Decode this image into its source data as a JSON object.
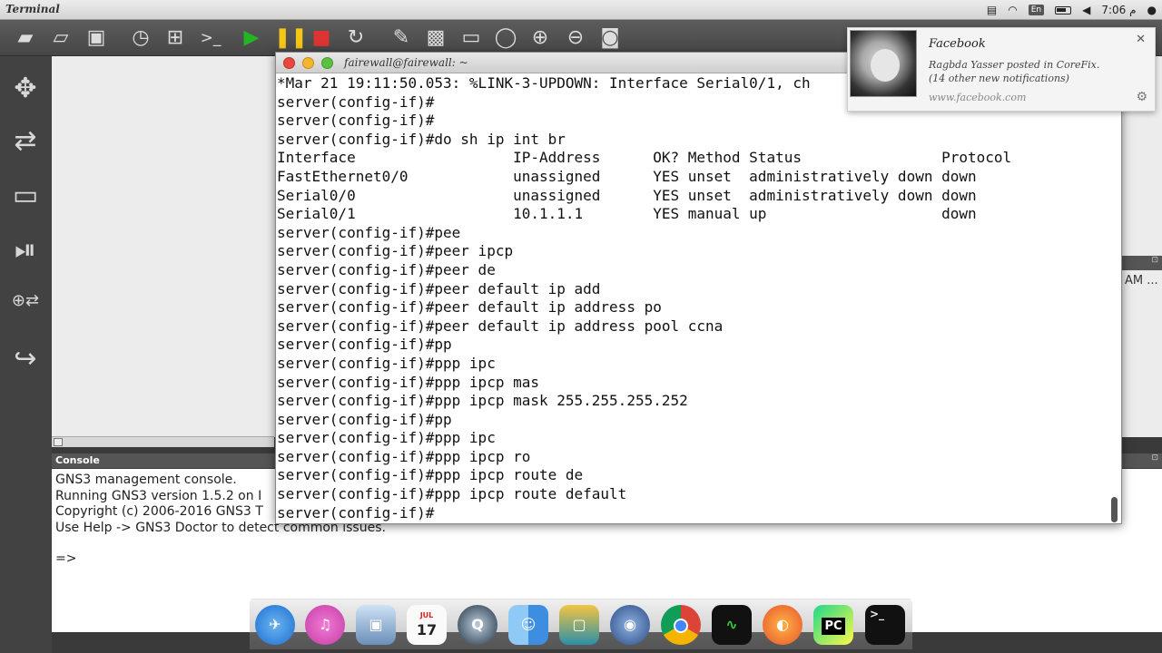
{
  "menubar": {
    "app_title": "Terminal",
    "language": "En",
    "time": "7:06 م",
    "tray_icons": [
      "app-indicator-icon",
      "wifi-icon",
      "language-icon",
      "battery-icon",
      "volume-icon",
      "apple-icon"
    ]
  },
  "toolbar": {
    "icons": [
      "open-folder-icon",
      "folder-icon",
      "save-icon",
      "clock-icon",
      "screenshot-region-icon",
      "console-prompt-icon",
      "play-icon",
      "pause-icon",
      "stop-icon",
      "reload-icon",
      "edit-icon",
      "image-icon",
      "rectangle-icon",
      "ellipse-icon",
      "zoom-in-icon",
      "zoom-out-icon",
      "camera-icon"
    ],
    "console_glyph": ">_"
  },
  "left_panel": {
    "icons": [
      "router-icon",
      "switch-icon",
      "end-device-icon",
      "security-device-icon",
      "all-devices-icon",
      "add-link-icon"
    ]
  },
  "terminal": {
    "title": "fairewall@fairewall: ~",
    "lines": [
      "*Mar 21 19:11:50.053: %LINK-3-UPDOWN: Interface Serial0/1, ch",
      "server(config-if)#",
      "server(config-if)#",
      "server(config-if)#do sh ip int br",
      "Interface                  IP-Address      OK? Method Status                Protocol",
      "FastEthernet0/0            unassigned      YES unset  administratively down down",
      "Serial0/0                  unassigned      YES unset  administratively down down",
      "Serial0/1                  10.1.1.1        YES manual up                    down",
      "server(config-if)#pee",
      "server(config-if)#peer ipcp",
      "server(config-if)#peer de",
      "server(config-if)#peer default ip add",
      "server(config-if)#peer default ip address po",
      "server(config-if)#peer default ip address pool ccna",
      "server(config-if)#pp",
      "server(config-if)#ppp ipc",
      "server(config-if)#ppp ipcp mas",
      "server(config-if)#ppp ipcp mask 255.255.255.252",
      "server(config-if)#pp",
      "server(config-if)#ppp ipc",
      "server(config-if)#ppp ipcp ro",
      "server(config-if)#ppp ipcp route de",
      "server(config-if)#ppp ipcp route default",
      "server(config-if)#"
    ]
  },
  "notification": {
    "title": "Facebook",
    "body": "Ragbda Yasser posted in CoreFix.",
    "body2": "(14 other new notifications)",
    "source": "www.facebook.com"
  },
  "console": {
    "title": "Console",
    "lines": [
      "GNS3 management console.",
      "Running GNS3 version 1.5.2 on I",
      "Copyright (c) 2006-2016 GNS3 T",
      "Use Help -> GNS3 Doctor to detect common issues."
    ],
    "prompt": "=>"
  },
  "right_panel": {
    "text": "AM ..."
  },
  "dock": {
    "calendar_month": "JUL",
    "calendar_day": "17",
    "pycharm_label": "PC",
    "terminal_glyph": ">_",
    "apps": [
      "safari-like-icon",
      "itunes-icon",
      "preview-icon",
      "calendar-icon",
      "quicktime-icon",
      "finder-icon",
      "archive-icon",
      "gns3-icon",
      "chrome-icon",
      "activity-monitor-icon",
      "firefox-icon",
      "pycharm-icon",
      "terminal-icon"
    ]
  }
}
